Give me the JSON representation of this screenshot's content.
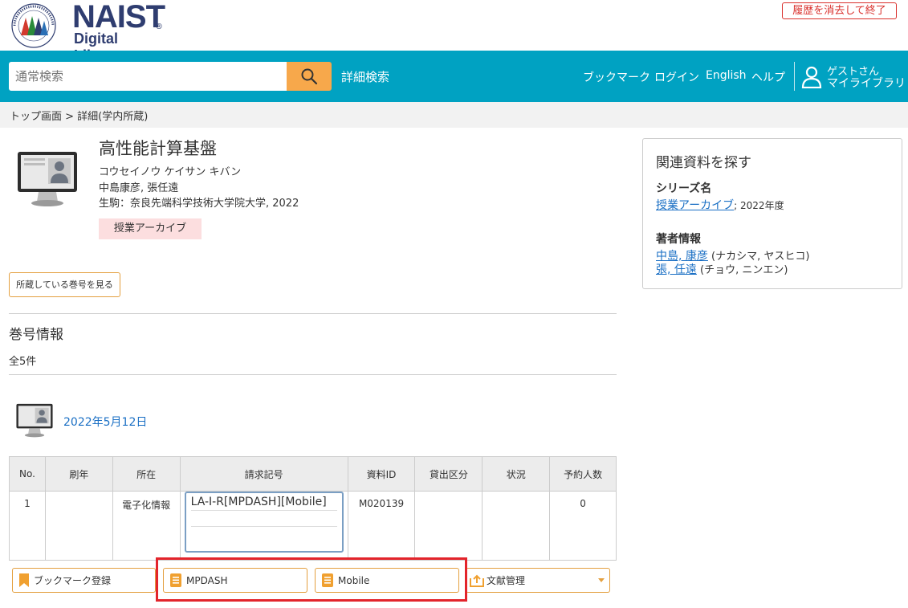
{
  "header": {
    "logo_title": "NAIST",
    "logo_reg": "®",
    "logo_subtitle": "Digital Library",
    "seal_text": "Nara Institute of Science and Technology",
    "seal_bottom": "NAIST",
    "clear_history": "履歴を消去して終了"
  },
  "nav": {
    "search_placeholder": "通常検索",
    "advanced_search": "詳細検索",
    "bookmark": "ブックマーク",
    "login": "ログイン",
    "english": "English",
    "help": "ヘルプ",
    "guest": "ゲストさん",
    "my_library": "マイライブラリ"
  },
  "breadcrumb": "トップ画面 > 詳細(学内所蔵)",
  "item": {
    "title": "高性能計算基盤",
    "title_kana": "コウセイノウ ケイサン キバン",
    "authors": "中島康彦, 張任遠",
    "publisher": "生駒：奈良先端科学技術大学院大学, 2022",
    "series_tag": "授業アーカイブ",
    "view_volumes": "所蔵している巻号を見る"
  },
  "volumes": {
    "heading": "巻号情報",
    "count": "全5件",
    "date": "2022年5月12日"
  },
  "table": {
    "headers": [
      "No.",
      "刷年",
      "所在",
      "請求記号",
      "資料ID",
      "貸出区分",
      "状況",
      "予約人数"
    ],
    "row": {
      "no": "1",
      "year": "",
      "location": "電子化情報",
      "call_number": "LA-I-R[MPDASH][Mobile]",
      "material_id": "M020139",
      "loan_type": "",
      "status": "",
      "reservations": "0"
    }
  },
  "actions": {
    "bookmark": "ブックマーク登録",
    "mpdash": "MPDASH",
    "mobile": "Mobile",
    "ref_manager": "文献管理"
  },
  "related": {
    "title": "関連資料を探す",
    "series_label": "シリーズ名",
    "series_link": "授業アーカイブ",
    "series_year": "; 2022年度",
    "author_label": "著者情報",
    "author1_link": "中島, 康彦",
    "author1_kana": " (ナカシマ, ヤスヒコ)",
    "author2_link": "張, 任遠",
    "author2_kana": " (チョウ, ニンエン)"
  },
  "colors": {
    "nav_bg": "#00a2c2",
    "search_button": "#f7a84b",
    "accent_orange": "#e4a040",
    "link": "#1a6fc4",
    "highlight_red": "#e3242b"
  }
}
